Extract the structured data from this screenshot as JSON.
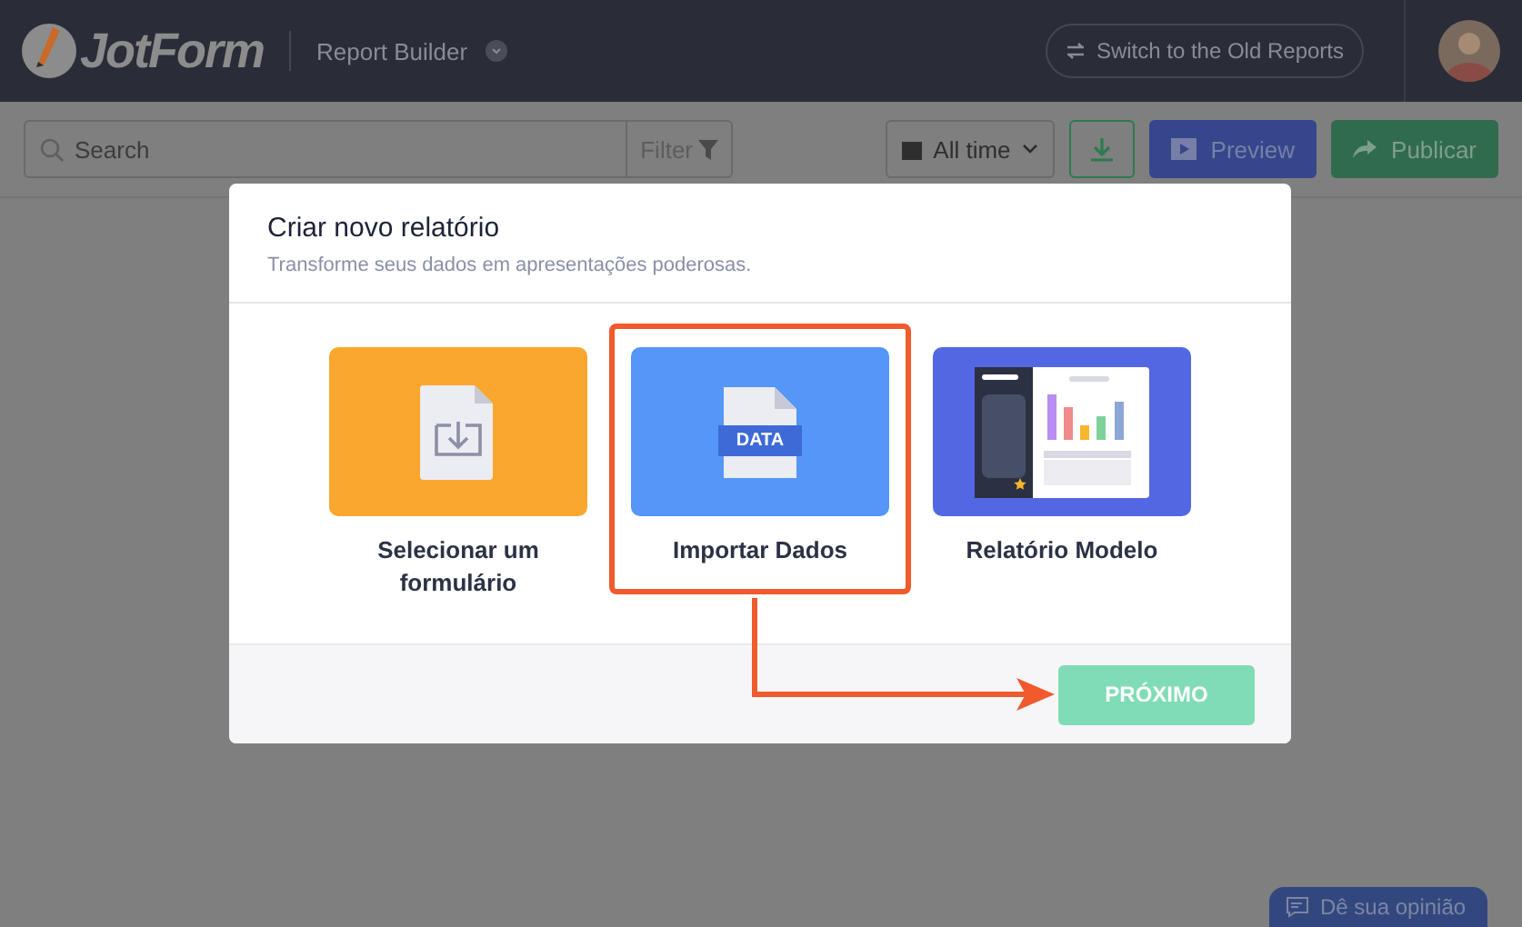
{
  "header": {
    "logo": "JotForm",
    "app_title": "Report Builder",
    "switch_button": "Switch to the Old Reports"
  },
  "toolbar": {
    "search": {
      "placeholder": "Search"
    },
    "filter": "Filter",
    "date_range": "All time",
    "preview": "Preview",
    "publish": "Publicar"
  },
  "modal": {
    "title": "Criar novo relatório",
    "subtitle": "Transforme seus dados em apresentações poderosas.",
    "options": [
      {
        "kind": "form",
        "label": "Selecionar um formulário",
        "color": "#f9a72f",
        "highlighted": false
      },
      {
        "kind": "data",
        "label": "Importar Dados",
        "badge": "DATA",
        "color": "#5497f8",
        "highlighted": true
      },
      {
        "kind": "template",
        "label": "Relatório Modelo",
        "color": "#5467e2",
        "highlighted": false
      }
    ],
    "next_button": {
      "label": "PRÓXIMO",
      "disabled": true
    }
  },
  "feedback_button": "Dê sua opinião"
}
